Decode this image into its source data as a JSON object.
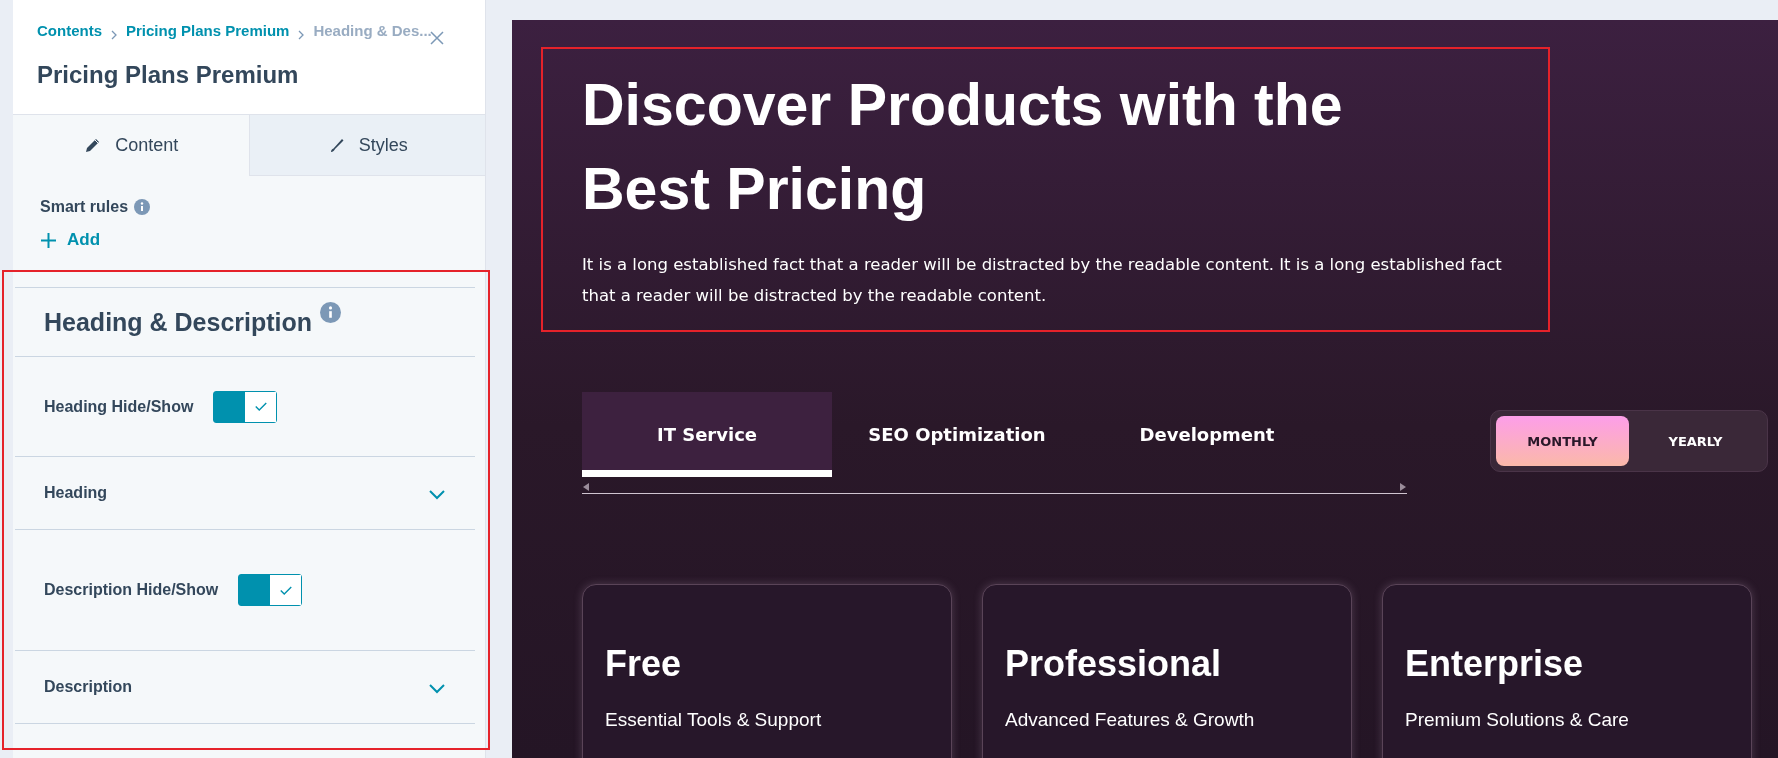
{
  "editor": {
    "breadcrumb": [
      {
        "label": "Contents",
        "current": false
      },
      {
        "label": "Pricing Plans Premium",
        "current": false
      },
      {
        "label": "Heading & Des...",
        "current": true
      }
    ],
    "title": "Pricing Plans Premium",
    "tabs": [
      {
        "label": "Content",
        "selected": true
      },
      {
        "label": "Styles",
        "selected": false
      }
    ],
    "smart_rules": {
      "label": "Smart rules",
      "action": "Add"
    },
    "section": {
      "title": "Heading & Description",
      "fields": [
        {
          "kind": "toggle",
          "label": "Heading Hide/Show",
          "on": true
        },
        {
          "kind": "dropdown",
          "label": "Heading",
          "expanded": false
        },
        {
          "kind": "toggle",
          "label": "Description Hide/Show",
          "on": true
        },
        {
          "kind": "dropdown",
          "label": "Description",
          "expanded": false
        }
      ]
    }
  },
  "preview": {
    "heading": "Discover Products with the Best Pricing",
    "description": "It is a long established fact that a reader will be distracted by the readable content. It is a long established fact that a reader will be distracted by the readable content.",
    "tabs": [
      {
        "label": "IT Service",
        "selected": true
      },
      {
        "label": "SEO Optimization",
        "selected": false
      },
      {
        "label": "Development",
        "selected": false
      }
    ],
    "billing": [
      {
        "label": "MONTHLY",
        "selected": true
      },
      {
        "label": "YEARLY",
        "selected": false
      }
    ],
    "plans": [
      {
        "name": "Free",
        "tagline": "Essential Tools & Support"
      },
      {
        "name": "Professional",
        "tagline": "Advanced Features & Growth"
      },
      {
        "name": "Enterprise",
        "tagline": "Premium Solutions & Care"
      }
    ]
  }
}
